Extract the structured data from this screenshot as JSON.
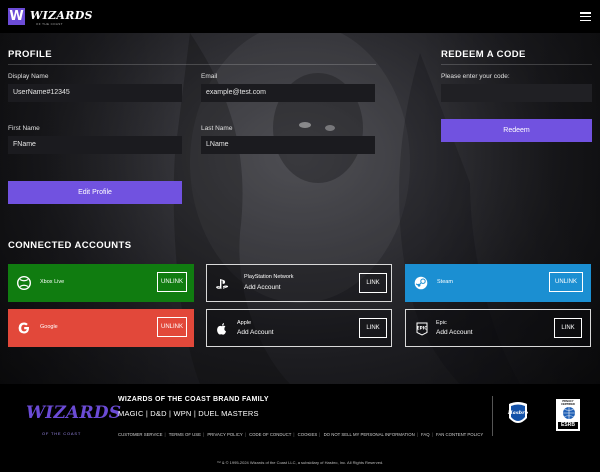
{
  "header": {
    "logo_letter": "W",
    "logo_text": "WIZARDS",
    "logo_subtext": "OF THE COAST",
    "menu_icon": "hamburger-menu-icon"
  },
  "profile": {
    "heading": "PROFILE",
    "display_name_label": "Display Name",
    "display_name_value": "UserName#12345",
    "email_label": "Email",
    "email_value": "example@test.com",
    "first_name_label": "First Name",
    "first_name_value": "FName",
    "last_name_label": "Last Name",
    "last_name_value": "LName",
    "edit_button": "Edit Profile"
  },
  "redeem": {
    "heading": "REDEEM A CODE",
    "prompt": "Please enter your code:",
    "code_value": "",
    "button": "Redeem"
  },
  "connected": {
    "heading": "CONNECTED ACCOUNTS",
    "accounts": [
      {
        "name": "Xbox Live",
        "status": "",
        "action": "UNLINK",
        "color": "#107c10",
        "icon": "xbox-icon"
      },
      {
        "name": "PlayStation Network",
        "status": "Add Account",
        "action": "LINK",
        "color": "",
        "icon": "playstation-icon"
      },
      {
        "name": "Steam",
        "status": "",
        "action": "UNLINK",
        "color": "#1b8fd2",
        "icon": "steam-icon"
      },
      {
        "name": "Google",
        "status": "",
        "action": "UNLINK",
        "color": "#e2483a",
        "icon": "google-icon"
      },
      {
        "name": "Apple",
        "status": "Add Account",
        "action": "LINK",
        "color": "",
        "icon": "apple-icon"
      },
      {
        "name": "Epic",
        "status": "Add Account",
        "action": "LINK",
        "color": "",
        "icon": "epic-games-icon"
      }
    ]
  },
  "footer": {
    "logo_text": "WIZARDS",
    "logo_subtext": "OF THE COAST",
    "title": "WIZARDS OF THE COAST BRAND FAMILY",
    "brands": "MAGIC | D&D | WPN | DUEL MASTERS",
    "links": [
      "CUSTOMER SERVICE",
      "TERMS OF USE",
      "PRIVACY POLICY",
      "CODE OF CONDUCT",
      "COOKIES",
      "DO NOT SELL MY PERSONAL INFORMATION",
      "FAQ",
      "FAN CONTENT POLICY"
    ],
    "copyright": "™ & © 1995-2024 Wizards of the Coast LLC, a subsidiary of Hasbro, Inc. All Rights Reserved.",
    "hasbro_logo": "Hasbro",
    "esrb_top": "PRIVACY CERTIFIED",
    "esrb_bottom": "ESRB"
  },
  "colors": {
    "accent_purple": "#7152e0",
    "xbox_green": "#107c10",
    "steam_blue": "#1b8fd2",
    "google_red": "#e2483a"
  }
}
